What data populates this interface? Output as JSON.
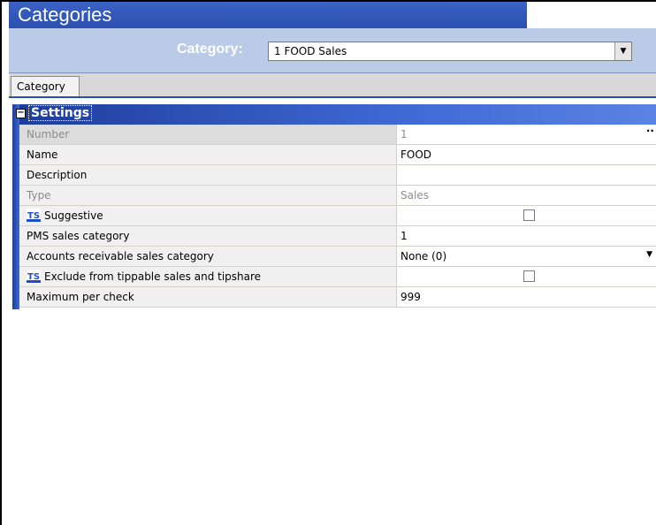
{
  "window": {
    "title": "Categories"
  },
  "category_bar": {
    "label": "Category:",
    "selected": "1 FOOD Sales"
  },
  "tabs": [
    {
      "label": "Category"
    }
  ],
  "section": {
    "label": "Settings"
  },
  "rows": [
    {
      "label": "Number",
      "value": "1"
    },
    {
      "label": "Name",
      "value": "FOOD"
    },
    {
      "label": "Description",
      "value": ""
    },
    {
      "label": "Type",
      "value": "Sales"
    },
    {
      "label": "Suggestive",
      "icon": "ts-icon",
      "checked": false
    },
    {
      "label": "PMS sales category",
      "value": "1"
    },
    {
      "label": "Accounts receivable sales category",
      "value": "None (0)"
    },
    {
      "label": "Exclude from tippable sales and tipshare",
      "icon": "ts-icon",
      "checked": false
    },
    {
      "label": "Maximum per check",
      "value": "999"
    }
  ],
  "colors": {
    "title_bar": "#2a4fb0",
    "category_bar": "#b9cbe6",
    "section_header": "#1e3d9b"
  }
}
